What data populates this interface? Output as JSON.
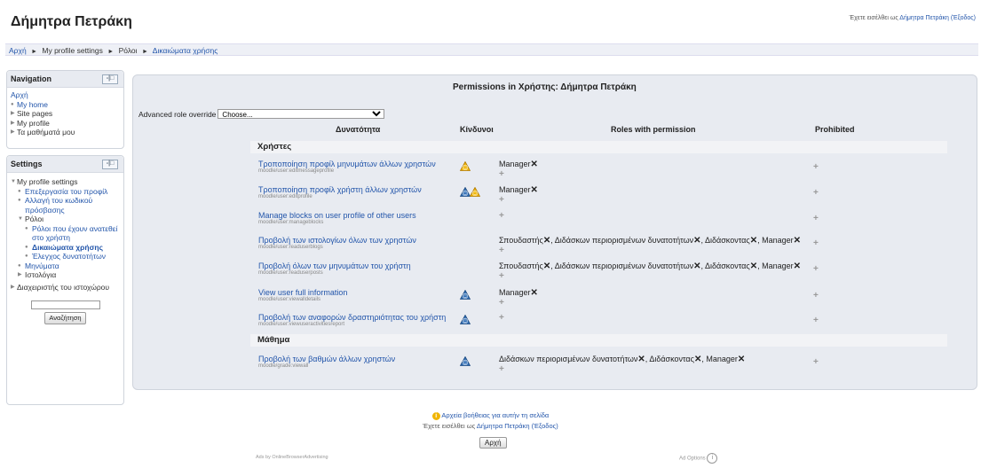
{
  "page": {
    "title": "Δήμητρα Πετράκη",
    "login_prefix": "Έχετε εισέλθει ως",
    "login_user": "Δήμητρα Πετράκη",
    "login_logout": "(Έξοδος)"
  },
  "breadcrumb": [
    {
      "label": "Αρχή",
      "link": true
    },
    {
      "label": "My profile settings",
      "link": false
    },
    {
      "label": "Ρόλοι",
      "link": false
    },
    {
      "label": "Δικαιώματα χρήσης",
      "link": true
    }
  ],
  "navigation": {
    "title": "Navigation",
    "ctrl": "-|□",
    "items": [
      {
        "label": "Αρχή"
      },
      {
        "label": "My home"
      },
      {
        "label": "Site pages"
      },
      {
        "label": "My profile"
      },
      {
        "label": "Τα μαθήματά μου"
      }
    ]
  },
  "settings": {
    "title": "Settings",
    "ctrl": "-|□",
    "items": {
      "profile": "My profile settings",
      "edit": "Επεξεργασία του προφίλ",
      "password": "Αλλαγή του κωδικού πρόσβασης",
      "roles": "Ρόλοι",
      "assigned": "Ρόλοι που έχουν ανατεθεί στο χρήστη",
      "permissions": "Δικαιώματα χρήσης",
      "check": "Έλεγχος δυνατοτήτων",
      "messages": "Μηνύματα",
      "blogs": "Ιστολόγια",
      "admin": "Διαχειριστής του ιστοχώρου"
    },
    "search_button": "Αναζήτηση"
  },
  "main": {
    "heading": "Permissions in Χρήστης: Δήμητρα Πετράκη",
    "override_label": "Advanced role override",
    "override_value": "Choose...",
    "columns": {
      "capability": "Δυνατότητα",
      "risks": "Κίνδυνοι",
      "roles": "Roles with permission",
      "prohibited": "Prohibited"
    },
    "sections": [
      {
        "name": "Χρήστες"
      },
      {
        "name": "Μάθημα"
      }
    ],
    "rows": [
      {
        "link": "Τροποποίηση προφίλ μηνυμάτων άλλων χρηστών",
        "code": "moodle/user:editmessageprofile",
        "risks": [
          "personal"
        ],
        "roles": [
          "Manager"
        ]
      },
      {
        "link": "Τροποποίηση προφίλ χρήστη άλλων χρηστών",
        "code": "moodle/user:editprofile",
        "risks": [
          "privacy",
          "personal"
        ],
        "roles": [
          "Manager"
        ]
      },
      {
        "link": "Manage blocks on user profile of other users",
        "code": "moodle/user:manageblocks",
        "risks": [],
        "roles": []
      },
      {
        "link": "Προβολή των ιστολογίων όλων των χρηστών",
        "code": "moodle/user:readuserblogs",
        "risks": [],
        "roles": [
          "Σπουδαστής",
          "Διδάσκων περιορισμένων δυνατοτήτων",
          "Διδάσκοντας",
          "Manager"
        ]
      },
      {
        "link": "Προβολή όλων των μηνυμάτων του χρήστη",
        "code": "moodle/user:readuserposts",
        "risks": [],
        "roles": [
          "Σπουδαστής",
          "Διδάσκων περιορισμένων δυνατοτήτων",
          "Διδάσκοντας",
          "Manager"
        ]
      },
      {
        "link": "View user full information",
        "code": "moodle/user:viewalldetails",
        "risks": [
          "privacy"
        ],
        "roles": [
          "Manager"
        ]
      },
      {
        "link": "Προβολή των αναφορών δραστηριότητας του χρήστη",
        "code": "moodle/user:viewuseractivitiesreport",
        "risks": [
          "privacy"
        ],
        "roles": []
      },
      {
        "link": "Προβολή των βαθμών άλλων χρηστών",
        "code": "moodle/grade:viewall",
        "risks": [
          "privacy"
        ],
        "roles": [
          "Διδάσκων περιορισμένων δυνατοτήτων",
          "Διδάσκοντας",
          "Manager"
        ]
      }
    ]
  },
  "footer": {
    "help": "Αρχεία βοήθειας για αυτήν τη σελίδα",
    "login_prefix": "Έχετε εισέλθει ως",
    "login_user": "Δήμητρα Πετράκη",
    "login_logout": "(Έξοδος)",
    "home_button": "Αρχή",
    "ads": "Ads by OnlineBrowserAdvertising",
    "ad_options": "Ad Options"
  },
  "colors": {
    "link": "#2255aa",
    "panel_bg": "#e8ebf1",
    "risk_personal": "#f0b400",
    "risk_privacy": "#2f6db5"
  }
}
